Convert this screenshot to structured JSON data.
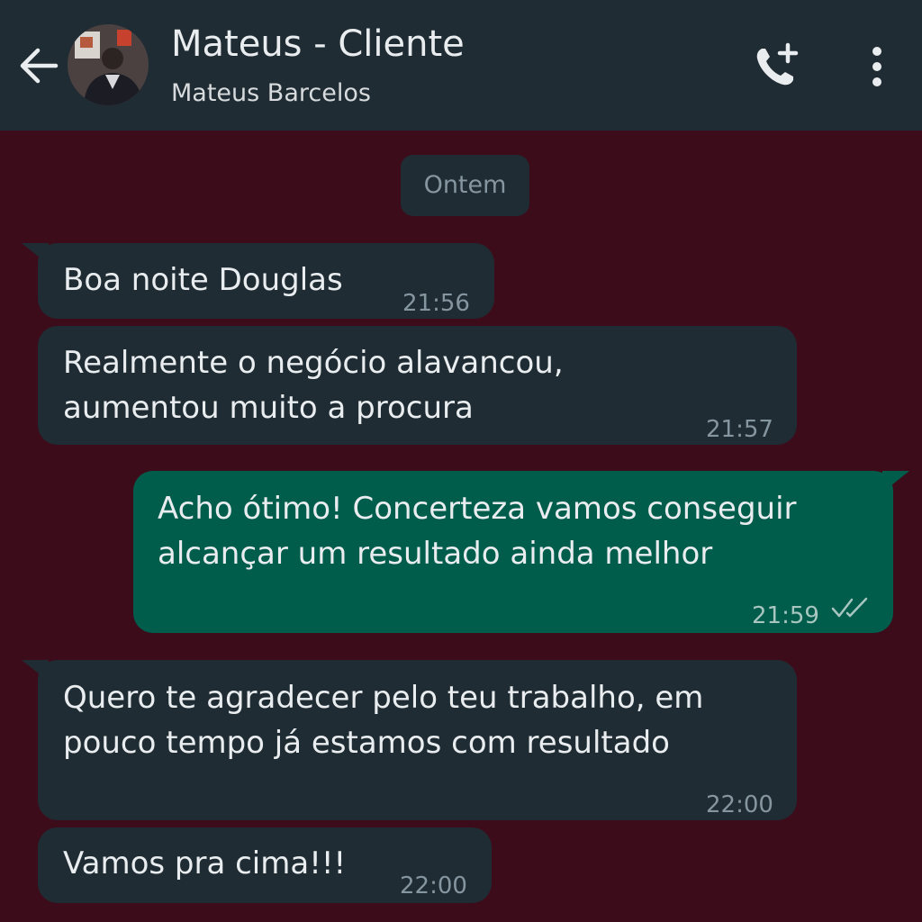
{
  "header": {
    "title": "Mateus - Cliente",
    "subtitle": "Mateus Barcelos",
    "icons": [
      "arrow-back-icon",
      "add-call-icon",
      "more-vert-icon"
    ]
  },
  "chat": {
    "date_label": "Ontem",
    "messages": [
      {
        "direction": "in",
        "text": "Boa noite Douglas",
        "time": "21:56"
      },
      {
        "direction": "in",
        "text": "Realmente o negócio alavancou,\naumentou muito a procura",
        "time": "21:57"
      },
      {
        "direction": "out",
        "text": "Acho ótimo! Concerteza vamos conseguir\nalcançar um resultado ainda melhor",
        "time": "21:59",
        "status": "read"
      },
      {
        "direction": "in",
        "text": "Quero te agradecer pelo teu trabalho, em\npouco tempo já estamos com resultado",
        "time": "22:00"
      },
      {
        "direction": "in",
        "text": "Vamos pra cima!!!",
        "time": "22:00"
      }
    ]
  },
  "colors": {
    "header_bg": "#202c33",
    "chat_bg": "#3d0c1b",
    "incoming_bubble": "#1f2c33",
    "outgoing_bubble": "#005c4b",
    "meta_text": "#8696a0"
  }
}
